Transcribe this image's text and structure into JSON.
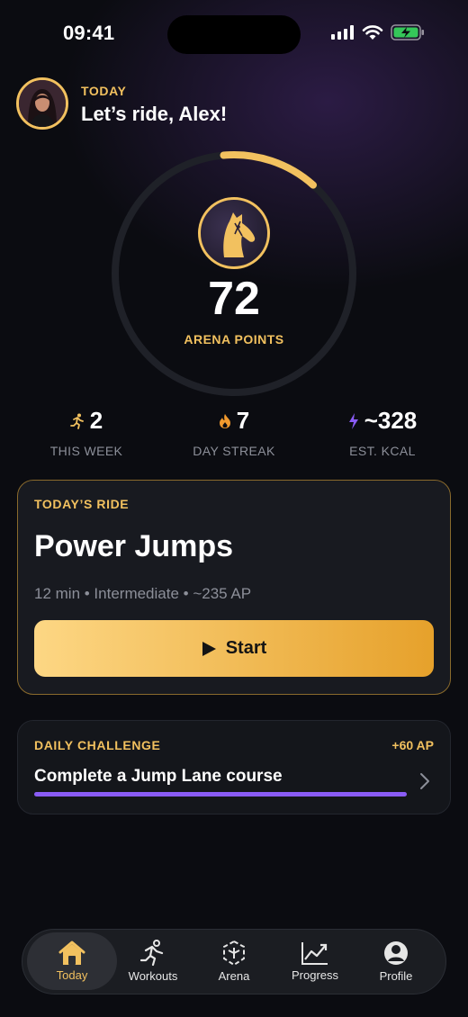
{
  "status_bar": {
    "time": "09:41"
  },
  "header": {
    "kicker": "TODAY",
    "greeting": "Let’s ride, Alex!"
  },
  "ring": {
    "points": "72",
    "label": "ARENA POINTS",
    "progress_fraction": 0.13,
    "accent": "#f2c15f"
  },
  "stats": [
    {
      "icon": "runner-icon",
      "value": "2",
      "label": "THIS WEEK",
      "color": "#f2c15f"
    },
    {
      "icon": "flame-icon",
      "value": "7",
      "label": "DAY STREAK",
      "color": "#f29a2e"
    },
    {
      "icon": "lightning-icon",
      "value": "~328",
      "label": "EST. KCAL",
      "color": "#8a5cf6"
    }
  ],
  "todays_ride": {
    "kicker": "TODAY’S RIDE",
    "title": "Power Jumps",
    "meta": "12 min • Intermediate • ~235 AP",
    "start_label": "Start"
  },
  "challenge": {
    "kicker": "DAILY CHALLENGE",
    "reward": "+60 AP",
    "title": "Complete a Jump Lane course",
    "progress": 1.0,
    "bar_color": "#8a5cf6"
  },
  "tabs": [
    {
      "label": "Today",
      "icon": "home-icon",
      "active": true
    },
    {
      "label": "Workouts",
      "icon": "runner-icon",
      "active": false
    },
    {
      "label": "Arena",
      "icon": "arena-icon",
      "active": false
    },
    {
      "label": "Progress",
      "icon": "chart-icon",
      "active": false
    },
    {
      "label": "Profile",
      "icon": "person-icon",
      "active": false
    }
  ]
}
